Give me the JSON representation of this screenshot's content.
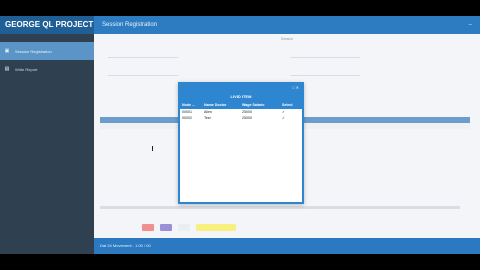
{
  "app": {
    "title": "GEORGE QL PROJECT",
    "page_title": "Session Registration"
  },
  "sidebar": {
    "items": [
      {
        "label": "Session Registration",
        "icon": "home-icon"
      },
      {
        "label": "Write Report",
        "icon": "document-icon"
      }
    ]
  },
  "form": {
    "title": "Session"
  },
  "modal": {
    "heading": "LIVID ITEM",
    "columns": [
      "Node ...",
      "Name Doctor",
      "Wage Salario",
      "Select"
    ],
    "rows": [
      {
        "id": "00001",
        "name": "Alien",
        "value": "25000"
      },
      {
        "id": "00002",
        "name": "Test",
        "value": "25000"
      }
    ]
  },
  "footer": {
    "text": "Dat 24 Movement - 1:00 / 00"
  },
  "colors": {
    "header": "#2d7cc2",
    "sidebar": "#2f4050",
    "modal_accent": "#2e86d1"
  }
}
